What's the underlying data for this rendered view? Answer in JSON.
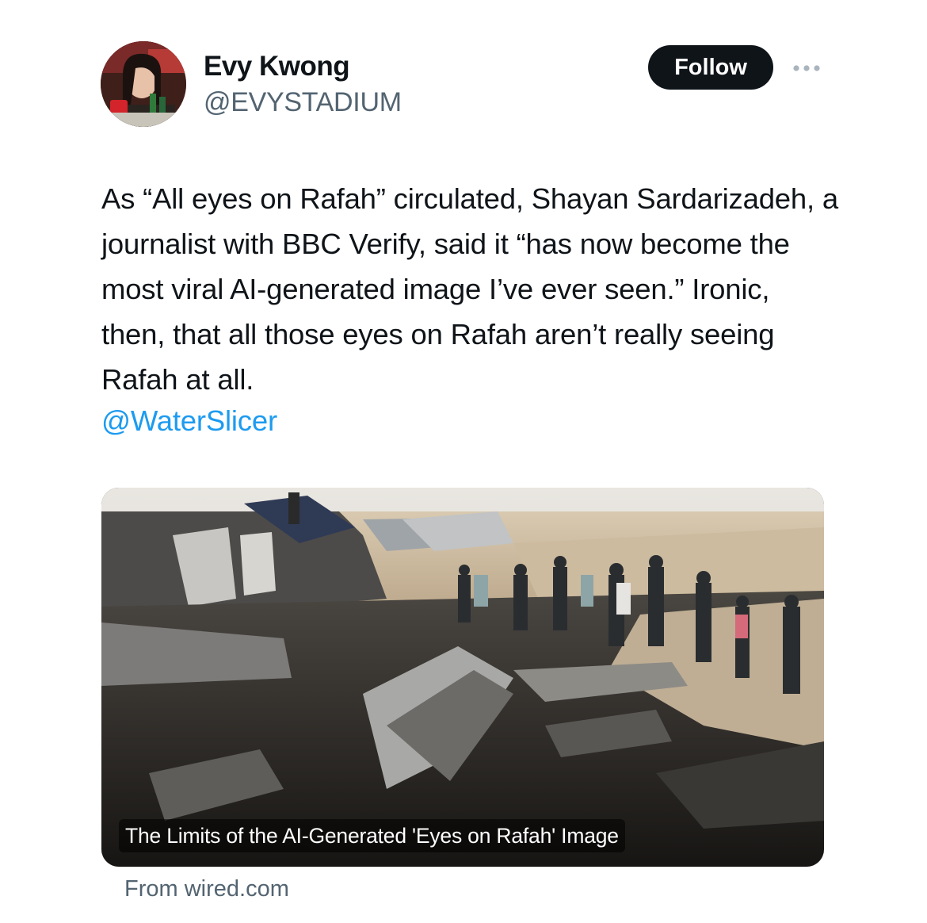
{
  "author": {
    "display_name": "Evy Kwong",
    "handle": "@EVYSTADIUM"
  },
  "actions": {
    "follow_label": "Follow"
  },
  "tweet": {
    "text": "As “All eyes on Rafah” circulated, Shayan Sardarizadeh, a journalist with BBC Verify, said it “has now become the most viral AI-generated image I’ve ever seen.” Ironic, then, that all those eyes on Rafah aren’t really seeing Rafah at all.",
    "mention": "@WaterSlicer"
  },
  "link_card": {
    "title": "The Limits of the AI-Generated 'Eyes on Rafah' Image",
    "source": "From wired.com"
  },
  "icons": {
    "more": "more-dots-icon"
  },
  "colors": {
    "text_primary": "#0f1419",
    "text_secondary": "#536471",
    "mention": "#1d9bf0",
    "follow_bg": "#0f1419"
  }
}
